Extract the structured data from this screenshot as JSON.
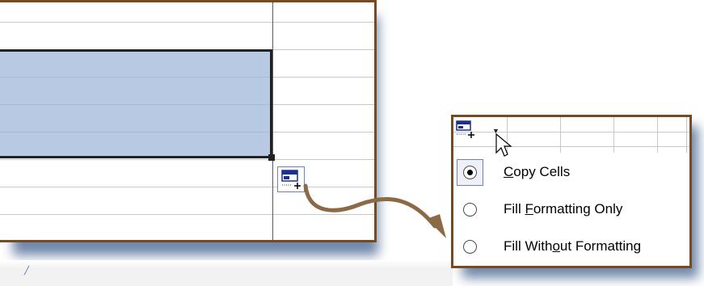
{
  "spreadsheet": {
    "selection_fill": "#b7c9e3",
    "frame_color": "#7a4a1f"
  },
  "smart_tag": {
    "icon": "auto-fill-options-icon"
  },
  "menu": {
    "dropdown_icon": "dropdown-arrow-icon",
    "options": [
      {
        "pre": "",
        "key": "C",
        "post": "opy Cells",
        "selected": true
      },
      {
        "pre": "Fill ",
        "key": "F",
        "post": "ormatting Only",
        "selected": false
      },
      {
        "pre": "Fill With",
        "key": "o",
        "post": "ut Formatting",
        "selected": false
      }
    ]
  },
  "colors": {
    "accent": "#6b83b8",
    "connector": "#8b6a45",
    "shadow": "#3f5f8c"
  }
}
